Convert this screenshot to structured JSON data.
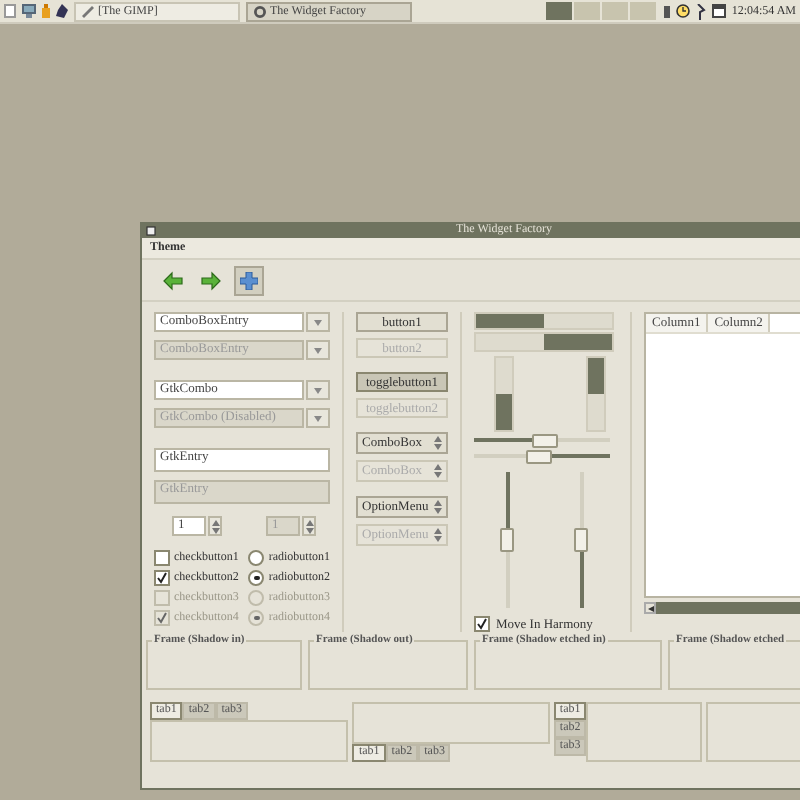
{
  "taskbar": {
    "tasks": [
      {
        "label": "[The GIMP]",
        "selected": false
      },
      {
        "label": "The Widget Factory",
        "selected": true
      }
    ],
    "clock": "12:04:54 AM"
  },
  "window": {
    "title": "The Widget Factory",
    "menu": [
      "Theme"
    ],
    "combos": [
      {
        "value": "ComboBoxEntry",
        "disabled": false
      },
      {
        "value": "ComboBoxEntry",
        "disabled": true
      },
      {
        "value": "GtkCombo",
        "disabled": false
      },
      {
        "value": "GtkCombo (Disabled)",
        "disabled": true
      }
    ],
    "entries": [
      {
        "value": "GtkEntry",
        "disabled": false
      },
      {
        "value": "GtkEntry",
        "disabled": true
      }
    ],
    "spins": [
      {
        "value": "1",
        "disabled": false
      },
      {
        "value": "1",
        "disabled": true
      }
    ],
    "checks": [
      {
        "label": "checkbutton1",
        "checked": false,
        "disabled": false
      },
      {
        "label": "checkbutton2",
        "checked": true,
        "disabled": false
      },
      {
        "label": "checkbutton3",
        "checked": false,
        "disabled": true
      },
      {
        "label": "checkbutton4",
        "checked": true,
        "disabled": true
      }
    ],
    "radios": [
      {
        "label": "radiobutton1",
        "selected": false,
        "disabled": false
      },
      {
        "label": "radiobutton2",
        "selected": true,
        "disabled": false
      },
      {
        "label": "radiobutton3",
        "selected": false,
        "disabled": true
      },
      {
        "label": "radiobutton4",
        "selected": true,
        "disabled": true
      }
    ],
    "buttons": [
      {
        "kind": "button",
        "label": "button1",
        "disabled": false
      },
      {
        "kind": "button",
        "label": "button2",
        "disabled": true
      },
      {
        "kind": "toggle",
        "label": "togglebutton1",
        "disabled": false,
        "on": true
      },
      {
        "kind": "toggle",
        "label": "togglebutton2",
        "disabled": true,
        "on": false
      },
      {
        "kind": "combo",
        "label": "ComboBox",
        "disabled": false
      },
      {
        "kind": "combo",
        "label": "ComboBox",
        "disabled": true
      },
      {
        "kind": "combo",
        "label": "OptionMenu",
        "disabled": false
      },
      {
        "kind": "combo",
        "label": "OptionMenu",
        "disabled": true
      }
    ],
    "progress_horizontal": [
      {
        "level": 0.5,
        "inverted": false
      },
      {
        "level": 0.5,
        "inverted": true
      }
    ],
    "progress_vertical": [
      {
        "level": 0.5,
        "inverted": false
      },
      {
        "level": 0.5,
        "inverted": true
      }
    ],
    "scales_horizontal": [
      {
        "level": 0.5,
        "inverted": false
      },
      {
        "level": 0.45,
        "inverted": true
      }
    ],
    "scales_vertical": [
      {
        "level": 0.5,
        "inverted": true
      },
      {
        "level": 0.5,
        "inverted": false
      }
    ],
    "harmony": {
      "label": "Move In Harmony",
      "checked": true
    },
    "tree": {
      "columns": [
        "Column1",
        "Column2"
      ]
    },
    "frames": [
      "Frame (Shadow in)",
      "Frame (Shadow out)",
      "Frame (Shadow etched in)",
      "Frame (Shadow etched"
    ],
    "notebooks": [
      {
        "tabs": [
          {
            "label": "tab1",
            "selected": true
          },
          {
            "label": "tab2",
            "selected": false
          },
          {
            "label": "tab3",
            "selected": false
          }
        ]
      },
      {
        "tabs": [
          {
            "label": "tab1",
            "selected": true
          },
          {
            "label": "tab2",
            "selected": false
          },
          {
            "label": "tab3",
            "selected": false
          }
        ]
      },
      {
        "tabs": [
          {
            "label": "tab1",
            "selected": true
          },
          {
            "label": "tab2",
            "selected": false
          },
          {
            "label": "tab3",
            "selected": false
          }
        ]
      }
    ]
  }
}
